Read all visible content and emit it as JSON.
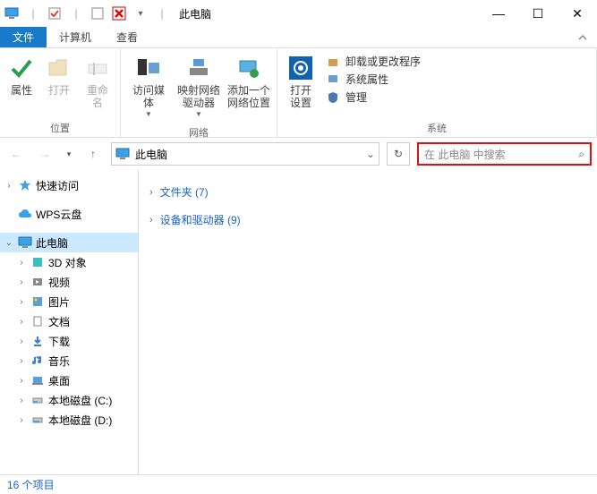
{
  "title": "此电脑",
  "window": {
    "min": "—",
    "max": "☐",
    "close": "✕"
  },
  "qat": {
    "sep": "|",
    "dropdown": "▾"
  },
  "tabs": {
    "file": "文件",
    "computer": "计算机",
    "view": "查看"
  },
  "ribbon": {
    "g1": {
      "label": "位置",
      "props": "属性",
      "open": "打开",
      "rename": "重命名"
    },
    "g2": {
      "label": "网络",
      "media": "访问媒体",
      "mapnet": "映射网络\n驱动器",
      "addloc": "添加一个\n网络位置"
    },
    "g3": {
      "label": "系统",
      "settings": "打开\n设置",
      "uninstall": "卸载或更改程序",
      "sysprops": "系统属性",
      "manage": "管理"
    }
  },
  "nav": {
    "back": "←",
    "fwd": "→",
    "hist": "▾",
    "up": "↑",
    "refresh": "↻",
    "drop": "⌄"
  },
  "address": {
    "location": "此电脑"
  },
  "search": {
    "placeholder": "在 此电脑 中搜索",
    "icon": "⌕"
  },
  "sidebar": {
    "quick": "快速访问",
    "wps": "WPS云盘",
    "thispc": "此电脑",
    "items": [
      {
        "label": "3D 对象"
      },
      {
        "label": "视频"
      },
      {
        "label": "图片"
      },
      {
        "label": "文档"
      },
      {
        "label": "下载"
      },
      {
        "label": "音乐"
      },
      {
        "label": "桌面"
      },
      {
        "label": "本地磁盘 (C:)"
      },
      {
        "label": "本地磁盘 (D:)"
      }
    ]
  },
  "content": {
    "folders": "文件夹 (7)",
    "drives": "设备和驱动器 (9)"
  },
  "status": {
    "text": "16 个项目"
  }
}
